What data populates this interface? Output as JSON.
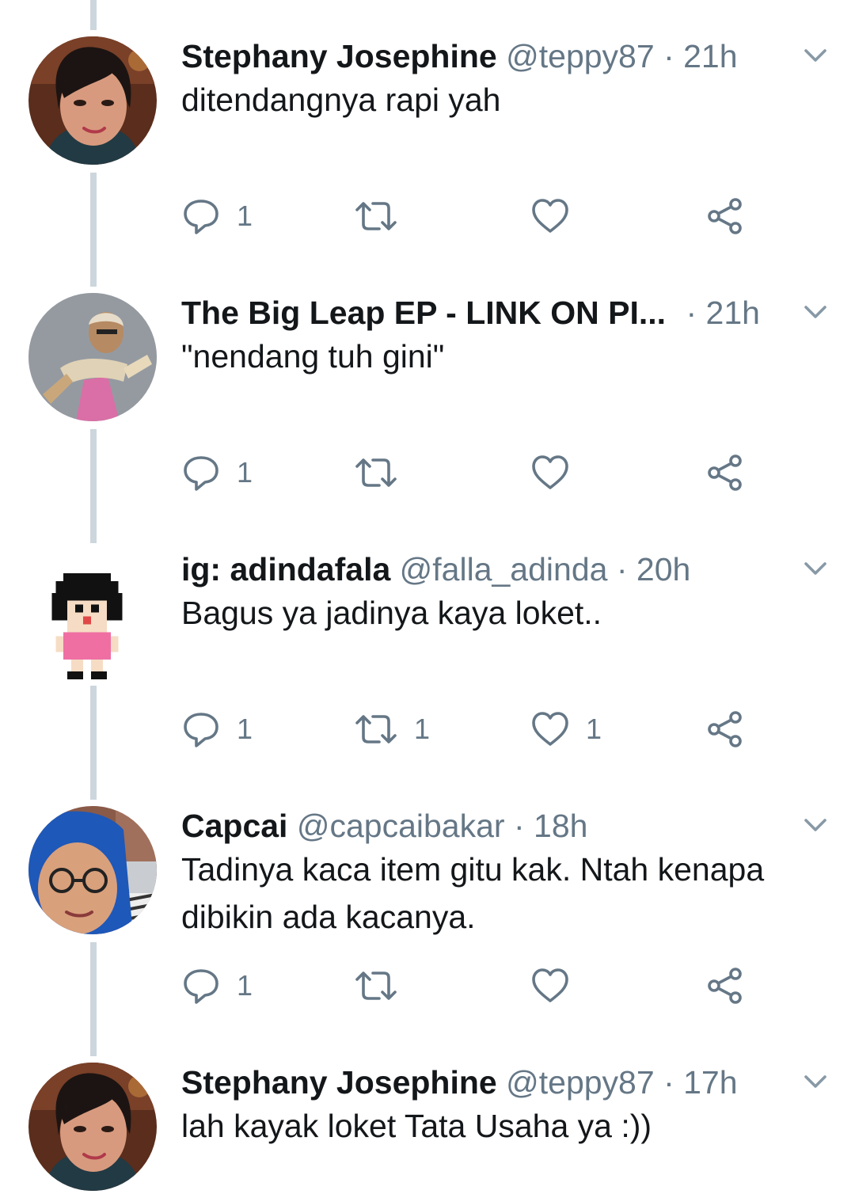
{
  "tweets": [
    {
      "name": "Stephany Josephine",
      "handle": "@teppy87",
      "separator": "·",
      "time": "21h",
      "text_lines": [
        "ditendangnya rapi yah"
      ],
      "reply_count": "1",
      "retweet_count": "",
      "like_count": "",
      "avatar": "woman-portrait"
    },
    {
      "name": "The Big Leap EP - LINK ON PI...",
      "handle": "",
      "separator": "·",
      "time": "21h",
      "text_lines": [
        "\"nendang tuh gini\""
      ],
      "reply_count": "1",
      "retweet_count": "",
      "like_count": "",
      "avatar": "man-dancing"
    },
    {
      "name": "ig: adindafala",
      "handle": "@falla_adinda",
      "separator": "·",
      "time": "20h",
      "text_lines": [
        "Bagus ya jadinya kaya loket.."
      ],
      "reply_count": "1",
      "retweet_count": "1",
      "like_count": "1",
      "avatar": "pixel-girl"
    },
    {
      "name": "Capcai",
      "handle": "@capcaibakar",
      "separator": "·",
      "time": "18h",
      "text_lines": [
        "Tadinya kaca item gitu kak. Ntah kenapa",
        "dibikin ada kacanya."
      ],
      "reply_count": "1",
      "retweet_count": "",
      "like_count": "",
      "avatar": "woman-hijab"
    },
    {
      "name": "Stephany Josephine",
      "handle": "@teppy87",
      "separator": "·",
      "time": "17h",
      "text_lines": [
        "lah kayak loket Tata Usaha ya :))"
      ],
      "reply_count": "",
      "retweet_count": "",
      "like_count": "",
      "avatar": "woman-portrait"
    }
  ],
  "colors": {
    "text": "#14171a",
    "secondary": "#657786",
    "thread_line": "#ccd6dd"
  },
  "icons": [
    "reply-icon",
    "retweet-icon",
    "like-icon",
    "share-icon",
    "caret-down-icon"
  ]
}
